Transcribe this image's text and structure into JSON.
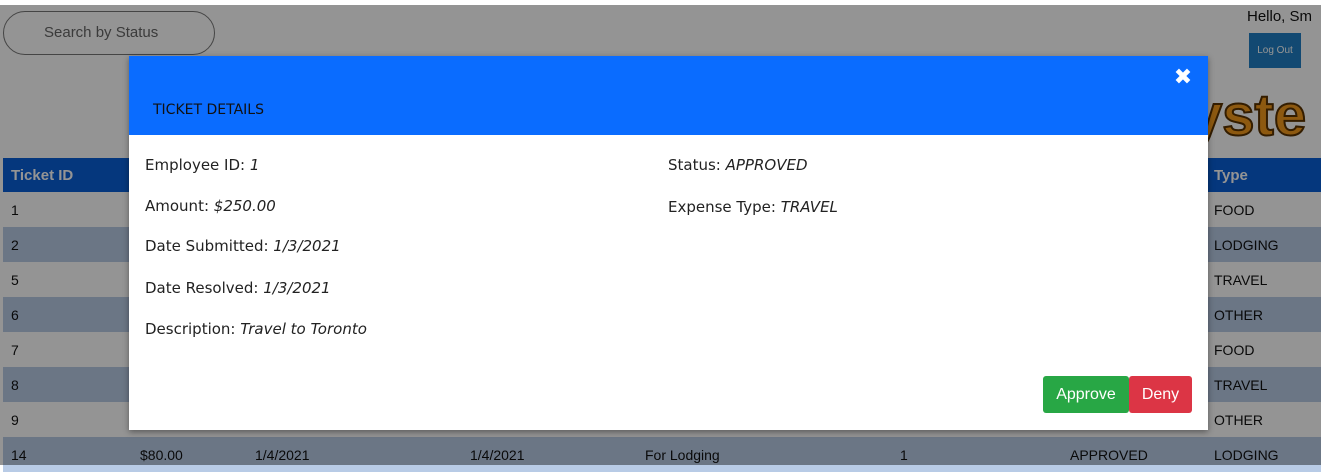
{
  "search": {
    "placeholder": "Search by Status"
  },
  "user": {
    "greeting": "Hello, Sm",
    "logout_label": "Log Out"
  },
  "logo": {
    "text": "yste"
  },
  "table": {
    "headers": [
      "Ticket ID",
      "",
      "",
      "",
      "",
      "",
      "",
      "Type"
    ],
    "rows": [
      {
        "id": "1",
        "amount": "",
        "submitted": "",
        "resolved": "",
        "description": "",
        "employee": "",
        "status": "",
        "type": "FOOD"
      },
      {
        "id": "2",
        "amount": "",
        "submitted": "",
        "resolved": "",
        "description": "",
        "employee": "",
        "status": "",
        "type": "LODGING"
      },
      {
        "id": "5",
        "amount": "",
        "submitted": "",
        "resolved": "",
        "description": "",
        "employee": "",
        "status": "",
        "type": "TRAVEL"
      },
      {
        "id": "6",
        "amount": "",
        "submitted": "",
        "resolved": "",
        "description": "",
        "employee": "",
        "status": "",
        "type": "OTHER"
      },
      {
        "id": "7",
        "amount": "",
        "submitted": "",
        "resolved": "",
        "description": "",
        "employee": "",
        "status": "",
        "type": "FOOD"
      },
      {
        "id": "8",
        "amount": "",
        "submitted": "",
        "resolved": "",
        "description": "",
        "employee": "",
        "status": "",
        "type": "TRAVEL"
      },
      {
        "id": "9",
        "amount": "",
        "submitted": "",
        "resolved": "",
        "description": "",
        "employee": "",
        "status": "",
        "type": "OTHER"
      },
      {
        "id": "14",
        "amount": "$80.00",
        "submitted": "1/4/2021",
        "resolved": "1/4/2021",
        "description": "For Lodging",
        "employee": "1",
        "status": "APPROVED",
        "type": "LODGING"
      }
    ]
  },
  "modal": {
    "title": "TICKET DETAILS",
    "close_glyph": "✖",
    "employee_id": {
      "label": "Employee ID: ",
      "value": "1"
    },
    "amount": {
      "label": "Amount: ",
      "value": "$250.00"
    },
    "date_submitted": {
      "label": "Date Submitted: ",
      "value": "1/3/2021"
    },
    "date_resolved": {
      "label": "Date Resolved: ",
      "value": "1/3/2021"
    },
    "description": {
      "label": "Description: ",
      "value": "Travel to Toronto"
    },
    "status": {
      "label": "Status: ",
      "value": "APPROVED"
    },
    "expense_type": {
      "label": "Expense Type: ",
      "value": "TRAVEL"
    },
    "approve_label": "Approve",
    "deny_label": "Deny"
  },
  "colors": {
    "header_blue": "#0a6cff",
    "table_header": "#0a5fd8",
    "approve": "#28a745",
    "deny": "#dc3545",
    "logout": "#1f7fc4",
    "logo_orange": "#f39a1c"
  }
}
